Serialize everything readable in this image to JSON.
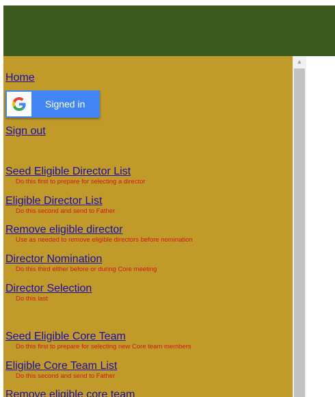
{
  "nav": {
    "home": "Home",
    "signed_in": "Signed in",
    "sign_out": "Sign out"
  },
  "director_links": [
    {
      "title": "Seed Eligible Director List",
      "desc": "Do this first to prepare for selecting a director"
    },
    {
      "title": "Eligible Director List",
      "desc": "Do this second and send to Father"
    },
    {
      "title": "Remove eligible director",
      "desc": "Use as needed to remove eligible directors before nomination"
    },
    {
      "title": "Director Nomination",
      "desc": "Do this third either before or during Core meeting"
    },
    {
      "title": "Director Selection",
      "desc": "Do this last"
    }
  ],
  "core_links": [
    {
      "title": "Seed Eligible Core Team",
      "desc": "Do this first to prepare for selecting new Core team members"
    },
    {
      "title": "Eligible Core Team List",
      "desc": "Do this second and send to Father"
    },
    {
      "title": "Remove eligible core team",
      "desc": ""
    }
  ],
  "colors": {
    "header": "#3d5a1e",
    "panel": "#c19b2a",
    "link": "#1a0dab",
    "description": "#d01818",
    "google_button": "#4285f4"
  },
  "icons": {
    "google": "google-g-icon",
    "scroll_up": "scroll-up-arrow-icon"
  }
}
